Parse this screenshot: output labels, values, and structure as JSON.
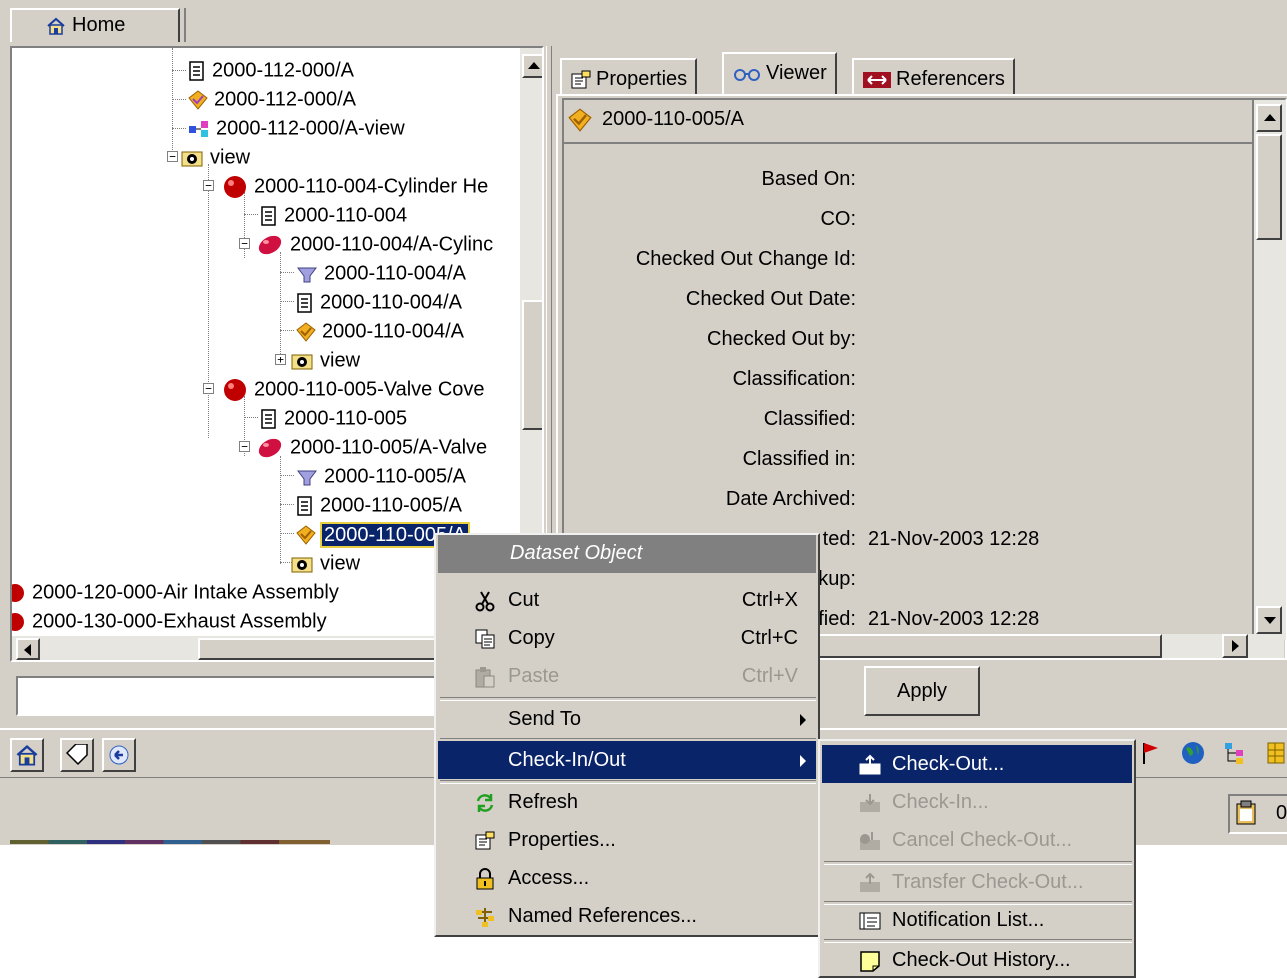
{
  "home_tab": {
    "label": "Home"
  },
  "tree": {
    "nodes": [
      {
        "label": "2000-112-000/A"
      },
      {
        "label": "2000-112-000/A"
      },
      {
        "label": "2000-112-000/A-view"
      },
      {
        "label": "view"
      },
      {
        "label": "2000-110-004-Cylinder He"
      },
      {
        "label": "2000-110-004"
      },
      {
        "label": "2000-110-004/A-Cylinc"
      },
      {
        "label": "2000-110-004/A"
      },
      {
        "label": "2000-110-004/A"
      },
      {
        "label": "2000-110-004/A"
      },
      {
        "label": "view"
      },
      {
        "label": "2000-110-005-Valve Cove"
      },
      {
        "label": "2000-110-005"
      },
      {
        "label": "2000-110-005/A-Valve"
      },
      {
        "label": "2000-110-005/A"
      },
      {
        "label": "2000-110-005/A"
      },
      {
        "label": "2000-110-005/A"
      },
      {
        "label": "view"
      },
      {
        "label": "2000-120-000-Air Intake Assembly"
      },
      {
        "label": "2000-130-000-Exhaust Assembly"
      }
    ]
  },
  "tabs": [
    {
      "label": "Properties"
    },
    {
      "label": "Viewer"
    },
    {
      "label": "Referencers"
    }
  ],
  "viewer": {
    "object_title": "2000-110-005/A",
    "properties": [
      {
        "label": "Based On:",
        "value": ""
      },
      {
        "label": "CO:",
        "value": ""
      },
      {
        "label": "Checked Out Change Id:",
        "value": ""
      },
      {
        "label": "Checked Out Date:",
        "value": ""
      },
      {
        "label": "Checked Out by:",
        "value": ""
      },
      {
        "label": "Classification:",
        "value": ""
      },
      {
        "label": "Classified:",
        "value": ""
      },
      {
        "label": "Classified in:",
        "value": ""
      },
      {
        "label": "Date Archived:",
        "value": ""
      },
      {
        "label": "ted:",
        "value": "21-Nov-2003 12:28"
      },
      {
        "label": "kup:",
        "value": ""
      },
      {
        "label": "fied:",
        "value": "21-Nov-2003 12:28"
      }
    ],
    "apply_label": "Apply"
  },
  "status_box": {
    "text": "0"
  },
  "context_menu": {
    "title": "Dataset Object",
    "items": [
      {
        "label": "Cut",
        "shortcut": "Ctrl+X"
      },
      {
        "label": "Copy",
        "shortcut": "Ctrl+C"
      },
      {
        "label": "Paste",
        "shortcut": "Ctrl+V"
      },
      {
        "label": "Send To"
      },
      {
        "label": "Check-In/Out"
      },
      {
        "label": "Refresh"
      },
      {
        "label": "Properties..."
      },
      {
        "label": "Access..."
      },
      {
        "label": "Named References..."
      }
    ]
  },
  "submenu": {
    "items": [
      {
        "label": "Check-Out..."
      },
      {
        "label": "Check-In..."
      },
      {
        "label": "Cancel Check-Out..."
      },
      {
        "label": "Transfer Check-Out..."
      },
      {
        "label": "Notification List..."
      },
      {
        "label": "Check-Out History..."
      }
    ]
  },
  "colors": {
    "selection": "#0a246a",
    "window": "#d4d0c8",
    "disabled": "#9a9890"
  }
}
